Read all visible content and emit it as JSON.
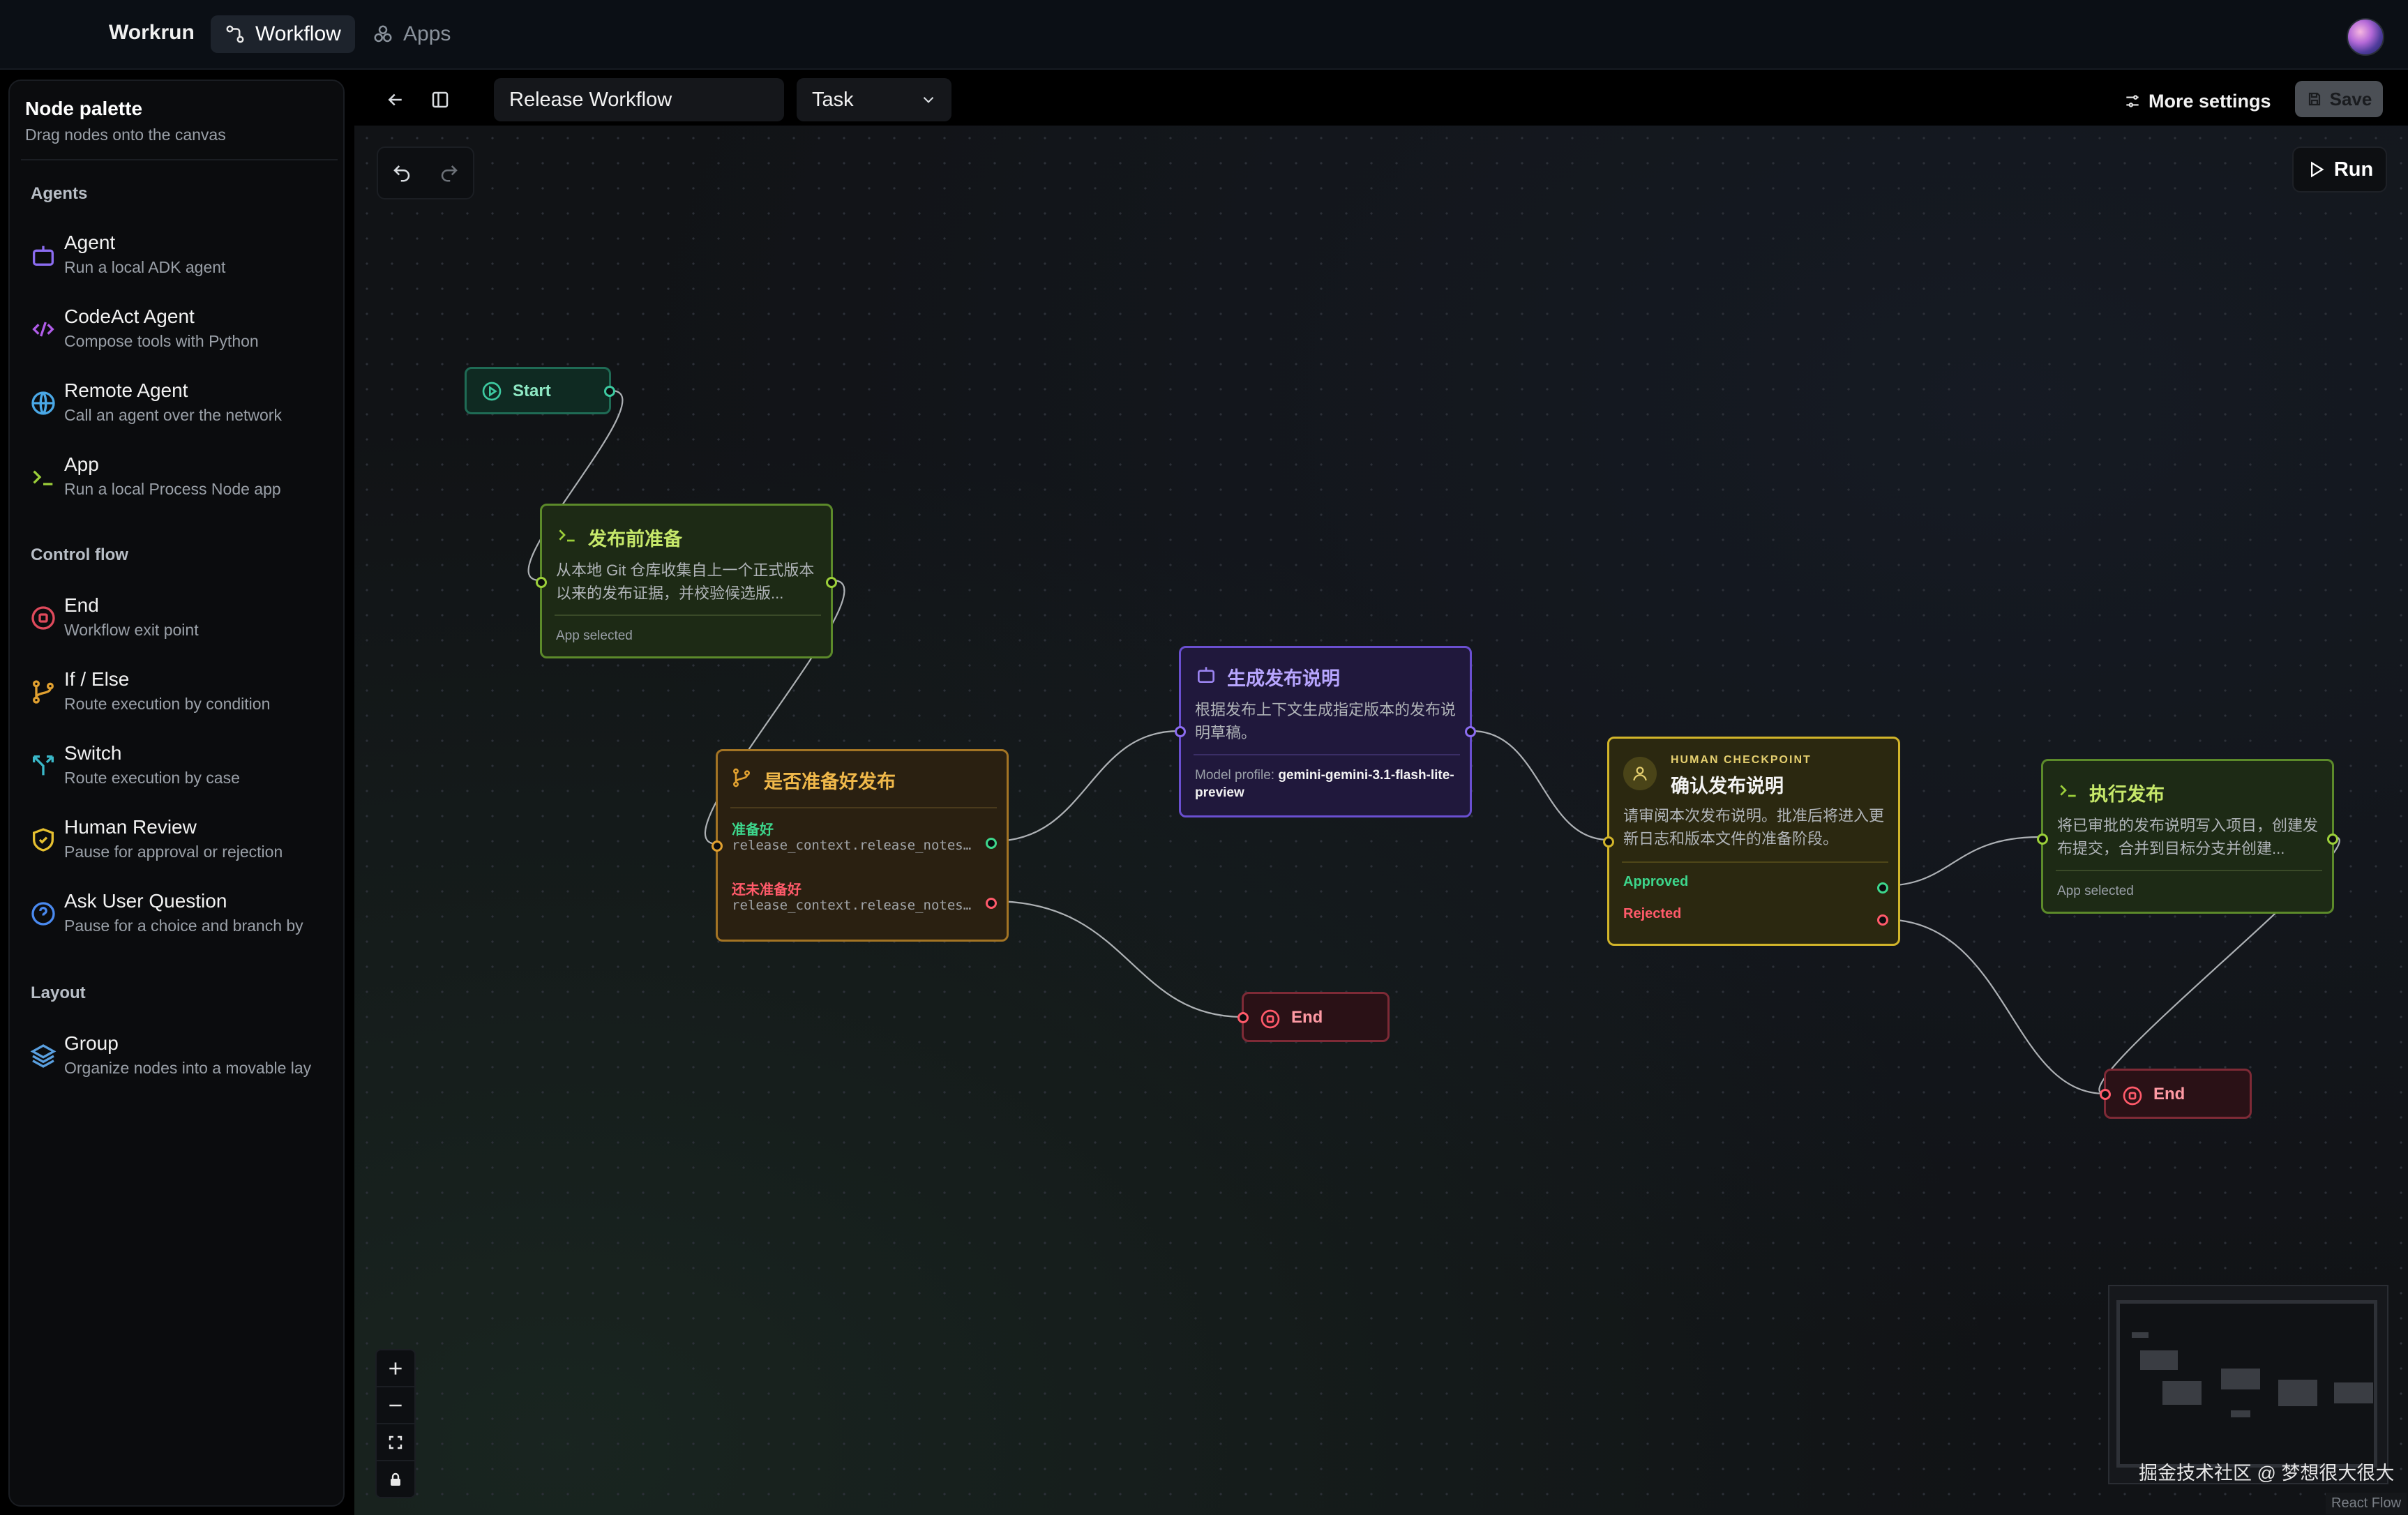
{
  "topbar": {
    "brand": "Workrun",
    "tabs": [
      {
        "label": "Workflow"
      },
      {
        "label": "Apps"
      }
    ]
  },
  "palette": {
    "title": "Node palette",
    "subtitle": "Drag nodes onto the canvas",
    "sections": {
      "agents": "Agents",
      "control": "Control flow",
      "layout": "Layout"
    },
    "items": [
      {
        "title": "Agent",
        "desc": "Run a local ADK agent",
        "icon": "robot-icon",
        "color": "#8b6cf0"
      },
      {
        "title": "CodeAct Agent",
        "desc": "Compose tools with Python",
        "icon": "code-icon",
        "color": "#b05ce8"
      },
      {
        "title": "Remote Agent",
        "desc": "Call an agent over the network",
        "icon": "globe-icon",
        "color": "#4aa8e6"
      },
      {
        "title": "App",
        "desc": "Run a local Process Node app",
        "icon": "terminal-icon",
        "color": "#9ccf3a"
      },
      {
        "title": "End",
        "desc": "Workflow exit point",
        "icon": "stop-circle-icon",
        "color": "#e04a5c"
      },
      {
        "title": "If / Else",
        "desc": "Route execution by condition",
        "icon": "branch-icon",
        "color": "#e0a030"
      },
      {
        "title": "Switch",
        "desc": "Route execution by case",
        "icon": "split-icon",
        "color": "#3ab8c8"
      },
      {
        "title": "Human Review",
        "desc": "Pause for approval or rejection",
        "icon": "shield-icon",
        "color": "#e6c030"
      },
      {
        "title": "Ask User Question",
        "desc": "Pause for a choice and branch by",
        "icon": "question-icon",
        "color": "#4a8af0"
      },
      {
        "title": "Group",
        "desc": "Organize nodes into a movable lay",
        "icon": "layers-icon",
        "color": "#5aa0e0"
      }
    ]
  },
  "toolbar": {
    "workflow_name": "Release Workflow",
    "workflow_type": "Task",
    "more_settings": "More settings",
    "save": "Save"
  },
  "canvas": {
    "run": "Run",
    "nodes": {
      "start": {
        "title": "Start"
      },
      "prep": {
        "title": "发布前准备",
        "desc": "从本地 Git 仓库收集自上一个正式版本以来的发布证据，并校验候选版...",
        "footer": "App selected"
      },
      "ifelse": {
        "title": "是否准备好发布",
        "branches": [
          {
            "label": "准备好",
            "expr": "release_context.release_notes…"
          },
          {
            "label": "还未准备好",
            "expr": "release_context.release_notes…"
          }
        ]
      },
      "agent": {
        "title": "生成发布说明",
        "desc": "根据发布上下文生成指定版本的发布说明草稿。",
        "footer_label": "Model profile: ",
        "footer_value": "gemini-gemini-3.1-flash-lite-preview"
      },
      "human": {
        "kicker": "HUMAN CHECKPOINT",
        "title": "确认发布说明",
        "desc": "请审阅本次发布说明。批准后将进入更新日志和版本文件的准备阶段。",
        "approved": "Approved",
        "rejected": "Rejected"
      },
      "publish": {
        "title": "执行发布",
        "desc": "将已审批的发布说明写入项目，创建发布提交，合并到目标分支并创建...",
        "footer": "App selected"
      },
      "end1": {
        "title": "End"
      },
      "end2": {
        "title": "End"
      }
    },
    "watermark": "掘金技术社区 @ 梦想很大很大",
    "attribution": "React Flow",
    "colors": {
      "success": "#3dd68c",
      "danger": "#ff5a6a",
      "warning": "#e0a030",
      "agent": "#8b6cf0",
      "app": "#9ccf3a"
    }
  }
}
